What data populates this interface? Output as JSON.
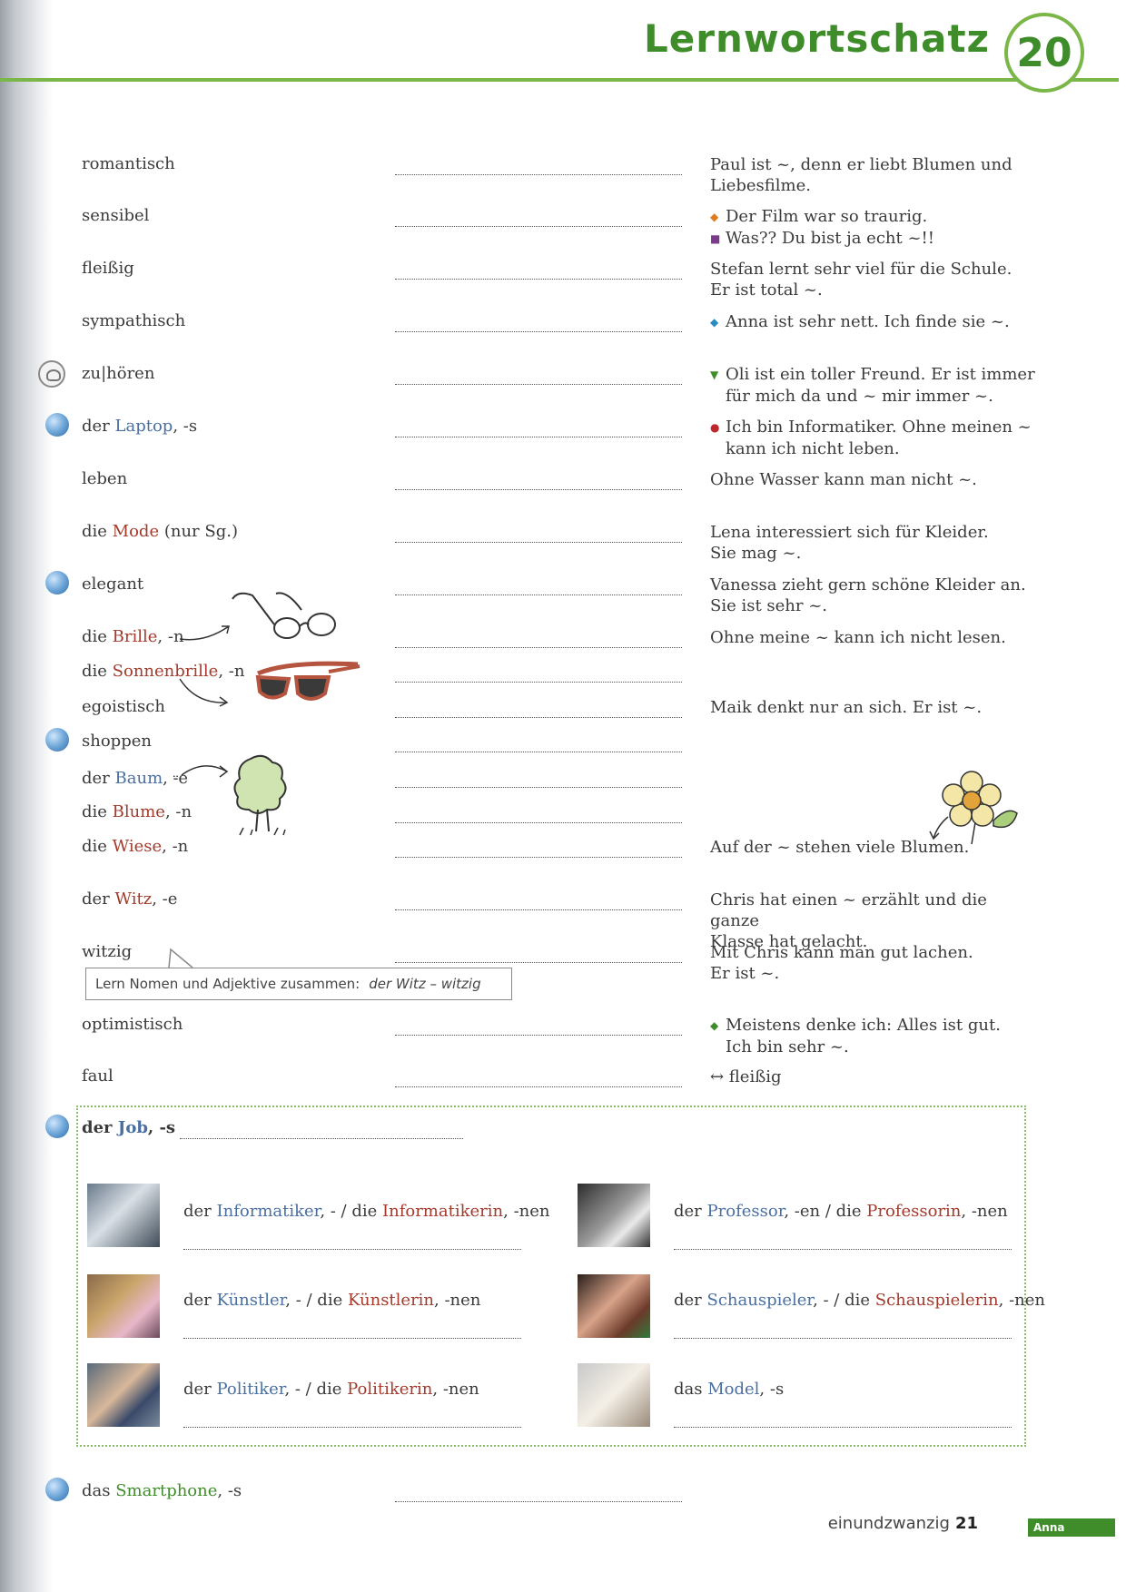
{
  "header": {
    "title": "Lernwortschatz",
    "chapter": "20"
  },
  "vocab": [
    {
      "pre": "",
      "word": "romantisch",
      "hl": "",
      "post": "",
      "ex": [
        "Paul ist ~, denn er liebt Blumen und",
        "Liebesfilme."
      ]
    },
    {
      "pre": "",
      "word": "sensibel",
      "hl": "",
      "post": "",
      "ex": [
        "Der Film war so traurig.",
        "Was?? Du bist ja echt ~!!"
      ]
    },
    {
      "pre": "",
      "word": "fleißig",
      "hl": "",
      "post": "",
      "ex": [
        "Stefan lernt sehr viel für die Schule.",
        "Er ist total ~."
      ]
    },
    {
      "pre": "",
      "word": "sympathisch",
      "hl": "",
      "post": "",
      "ex": [
        "Anna ist sehr nett. Ich finde sie ~."
      ]
    },
    {
      "pre": "",
      "word": "zu|hören",
      "hl": "",
      "post": "",
      "ex": [
        "Oli ist ein toller Freund. Er ist immer",
        "für mich da und ~ mir immer ~."
      ]
    },
    {
      "pre": "der ",
      "word": "",
      "hl": "Laptop",
      "post": ", -s",
      "ex": [
        "Ich bin Informatiker. Ohne meinen ~",
        "kann ich nicht leben."
      ]
    },
    {
      "pre": "",
      "word": "leben",
      "hl": "",
      "post": "",
      "ex": [
        "Ohne Wasser kann man nicht ~."
      ]
    },
    {
      "pre": "die ",
      "word": "",
      "hl": "Mode",
      "post": " (nur Sg.)",
      "ex": [
        "Lena interessiert sich für Kleider.",
        "Sie mag ~."
      ]
    },
    {
      "pre": "",
      "word": "elegant",
      "hl": "",
      "post": "",
      "ex": [
        "Vanessa zieht gern schöne Kleider an.",
        "Sie ist sehr ~."
      ]
    },
    {
      "pre": "die ",
      "word": "",
      "hl": "Brille",
      "post": ", -n",
      "ex": [
        "Ohne meine ~ kann ich nicht lesen."
      ]
    },
    {
      "pre": "die ",
      "word": "",
      "hl": "Sonnenbrille",
      "post": ", -n",
      "ex": []
    },
    {
      "pre": "",
      "word": "egoistisch",
      "hl": "",
      "post": "",
      "ex": [
        "Maik denkt nur an sich. Er ist ~."
      ]
    },
    {
      "pre": "",
      "word": "shoppen",
      "hl": "",
      "post": "",
      "ex": []
    },
    {
      "pre": "der ",
      "word": "",
      "hl": "Baum",
      "post": ", ⸚e",
      "ex": []
    },
    {
      "pre": "die ",
      "word": "",
      "hl": "Blume",
      "post": ", -n",
      "ex": []
    },
    {
      "pre": "die ",
      "word": "",
      "hl": "Wiese",
      "post": ", -n",
      "ex": [
        "Auf der ~ stehen viele Blumen."
      ]
    },
    {
      "pre": "der ",
      "word": "",
      "hl": "Witz",
      "post": ", -e",
      "ex": [
        "Chris hat einen ~ erzählt und die ganze",
        "Klasse hat gelacht."
      ]
    },
    {
      "pre": "",
      "word": "witzig",
      "hl": "",
      "post": "",
      "ex": [
        "Mit Chris kann man gut lachen.",
        "Er ist ~."
      ]
    },
    {
      "pre": "",
      "word": "optimistisch",
      "hl": "",
      "post": "",
      "ex": [
        "Meistens denke ich: Alles ist gut.",
        "Ich bin sehr ~."
      ]
    },
    {
      "pre": "",
      "word": "faul",
      "hl": "",
      "post": "",
      "ex": [
        "↔ fleißig"
      ]
    }
  ],
  "tip": {
    "text": "Lern Nomen und Adjektive zusammen:",
    "example": "der Witz – witzig"
  },
  "job_header": {
    "pre": "der ",
    "hl": "Job",
    "post": ", -s"
  },
  "jobs": [
    {
      "a_pre": "der ",
      "a_hl": "Informatiker",
      "a_post": ", - / die ",
      "b_hl": "Informatikerin",
      "b_post": ", -nen"
    },
    {
      "a_pre": "der ",
      "a_hl": "Professor",
      "a_post": ", -en / die ",
      "b_hl": "Professorin",
      "b_post": ", -nen"
    },
    {
      "a_pre": "der ",
      "a_hl": "Künstler",
      "a_post": ", - / die ",
      "b_hl": "Künstlerin",
      "b_post": ", -nen"
    },
    {
      "a_pre": "der ",
      "a_hl": "Schauspieler",
      "a_post": ", - / die ",
      "b_hl": "Schauspielerin",
      "b_post": ", -nen"
    },
    {
      "a_pre": "der ",
      "a_hl": "Politiker",
      "a_post": ", - / die ",
      "b_hl": "Politikerin",
      "b_post": ", -nen"
    },
    {
      "a_pre": "das ",
      "a_hl": "Model",
      "a_post": ", -s",
      "b_hl": "",
      "b_post": ""
    }
  ],
  "last": {
    "pre": "das ",
    "hl": "Smartphone",
    "post": ", -s"
  },
  "footer": {
    "page_word": "einundzwanzig",
    "page_num": "21",
    "tag": "Anna"
  },
  "colors": {
    "green": "#3f8d2a",
    "noun_red": "#a33a2c",
    "noun_blue": "#4a6fa0"
  }
}
